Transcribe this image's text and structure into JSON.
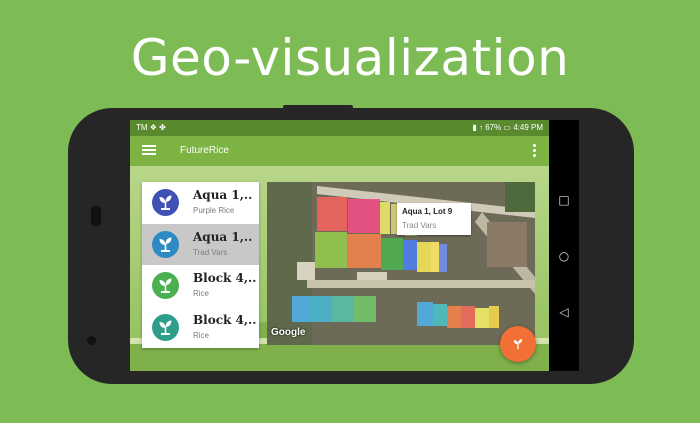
{
  "headline": "Geo-visualization",
  "status_bar": {
    "left": "TM ❖ ✤",
    "right": "▮ ↑ 67% ▭ 4:49 PM"
  },
  "app_bar": {
    "title": "FutureRice"
  },
  "list": {
    "items": [
      {
        "title": "Aqua 1,..",
        "subtitle": "Purple Rice",
        "icon_color": "#3f51b5",
        "icon": "sprout-icon",
        "selected": false
      },
      {
        "title": "Aqua 1,..",
        "subtitle": "Trad Vars",
        "icon_color": "#2e8ac2",
        "icon": "sprout-icon",
        "selected": true
      },
      {
        "title": "Block 4,..",
        "subtitle": "Rice",
        "icon_color": "#4caf50",
        "icon": "sprout-icon",
        "selected": false
      },
      {
        "title": "Block 4,..",
        "subtitle": "Rice",
        "icon_color": "#2e9e8a",
        "icon": "sprout-icon",
        "selected": false
      }
    ]
  },
  "map": {
    "tooltip": {
      "title": "Aqua 1, Lot 9",
      "subtitle": "Trad Vars"
    },
    "attribution": "Google"
  },
  "fab": {
    "icon": "sprout-icon",
    "color": "#f26f35"
  },
  "colors": {
    "background": "#7dbb55",
    "app_bar": "#7cb342",
    "status_bar": "#5a8a2e"
  }
}
